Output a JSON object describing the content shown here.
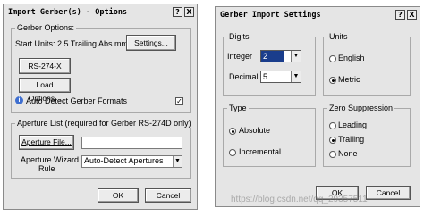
{
  "left_dialog": {
    "title": "Import Gerber(s) - Options",
    "help_btn": "?",
    "close_btn": "X",
    "gerber_options_label": "Gerber Options:",
    "start_units_text": "Start Units: 2.5 Trailing Abs mm",
    "settings_button": "Settings...",
    "rs274x_button": "RS-274-X",
    "load_options_button": "Load Options...",
    "auto_detect_label": "Auto Detect Gerber Formats",
    "auto_detect_checked": "✓",
    "aperture_list_label": "Aperture List (required for Gerber RS-274D only)",
    "aperture_file_button": "Aperture File...",
    "aperture_file_value": "",
    "aperture_wizard_label_line1": "Aperture Wizard",
    "aperture_wizard_label_line2": "Rule",
    "aperture_wizard_value": "Auto-Detect Apertures",
    "ok_button": "OK",
    "cancel_button": "Cancel"
  },
  "right_dialog": {
    "title": "Gerber Import Settings",
    "help_btn": "?",
    "close_btn": "X",
    "digits_label": "Digits",
    "integer_label": "Integer",
    "integer_value": "2",
    "decimal_label": "Decimal",
    "decimal_value": "5",
    "units_label": "Units",
    "english_label": "English",
    "metric_label": "Metric",
    "type_label": "Type",
    "absolute_label": "Absolute",
    "incremental_label": "Incremental",
    "zero_suppression_label": "Zero Suppression",
    "leading_label": "Leading",
    "trailing_label": "Trailing",
    "none_label": "None",
    "ok_button": "OK",
    "cancel_button": "Cancel"
  },
  "watermark": "https://blog.csdn.net/qq_29357511",
  "icons": {
    "dropdown": "▼",
    "help": "question-mark-icon",
    "close": "close-icon"
  },
  "colors": {
    "dialog_bg": "#e5e5e5",
    "selection": "#1a3d8c"
  }
}
